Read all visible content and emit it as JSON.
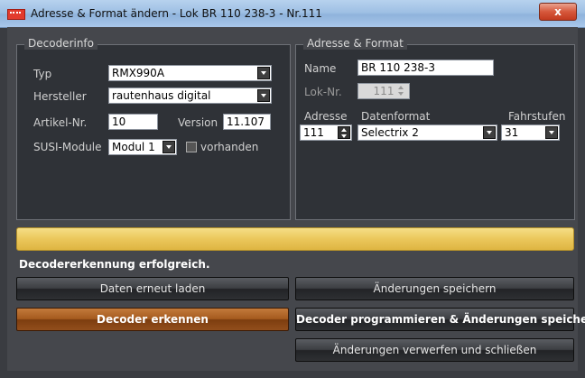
{
  "window": {
    "title": "Adresse & Format ändern - Lok BR 110 238-3 - Nr.111",
    "close_glyph": "x"
  },
  "decoderinfo": {
    "title": "Decoderinfo",
    "typ_label": "Typ",
    "typ_value": "RMX990A",
    "hersteller_label": "Hersteller",
    "hersteller_value": "rautenhaus digital",
    "artikel_label": "Artikel-Nr.",
    "artikel_value": "10",
    "version_label": "Version",
    "version_value": "11.107",
    "susi_label": "SUSI-Module",
    "susi_value": "Modul 1",
    "vorhanden_label": "vorhanden",
    "vorhanden_checked": false
  },
  "adresse_format": {
    "title": "Adresse & Format",
    "name_label": "Name",
    "name_value": "BR 110 238-3",
    "loknr_label": "Lok-Nr.",
    "loknr_value": "111",
    "adresse_label": "Adresse",
    "adresse_value": "111",
    "datenformat_label": "Datenformat",
    "datenformat_value": "Selectrix 2",
    "fahrstufen_label": "Fahrstufen",
    "fahrstufen_value": "31"
  },
  "progress": {
    "value_percent": 100,
    "color": "#ebc75b"
  },
  "status_text": "Decodererkennung erfolgreich.",
  "buttons": {
    "reload": "Daten erneut laden",
    "save": "Änderungen speichern",
    "detect": "Decoder erkennen",
    "program_save": "Decoder programmieren & Änderungen speichern",
    "discard_close": "Änderungen verwerfen und schließen"
  },
  "icons": {
    "app": "rail-app-icon",
    "dropdown": "chevron-down-icon",
    "spinner": "spinner-icon"
  }
}
